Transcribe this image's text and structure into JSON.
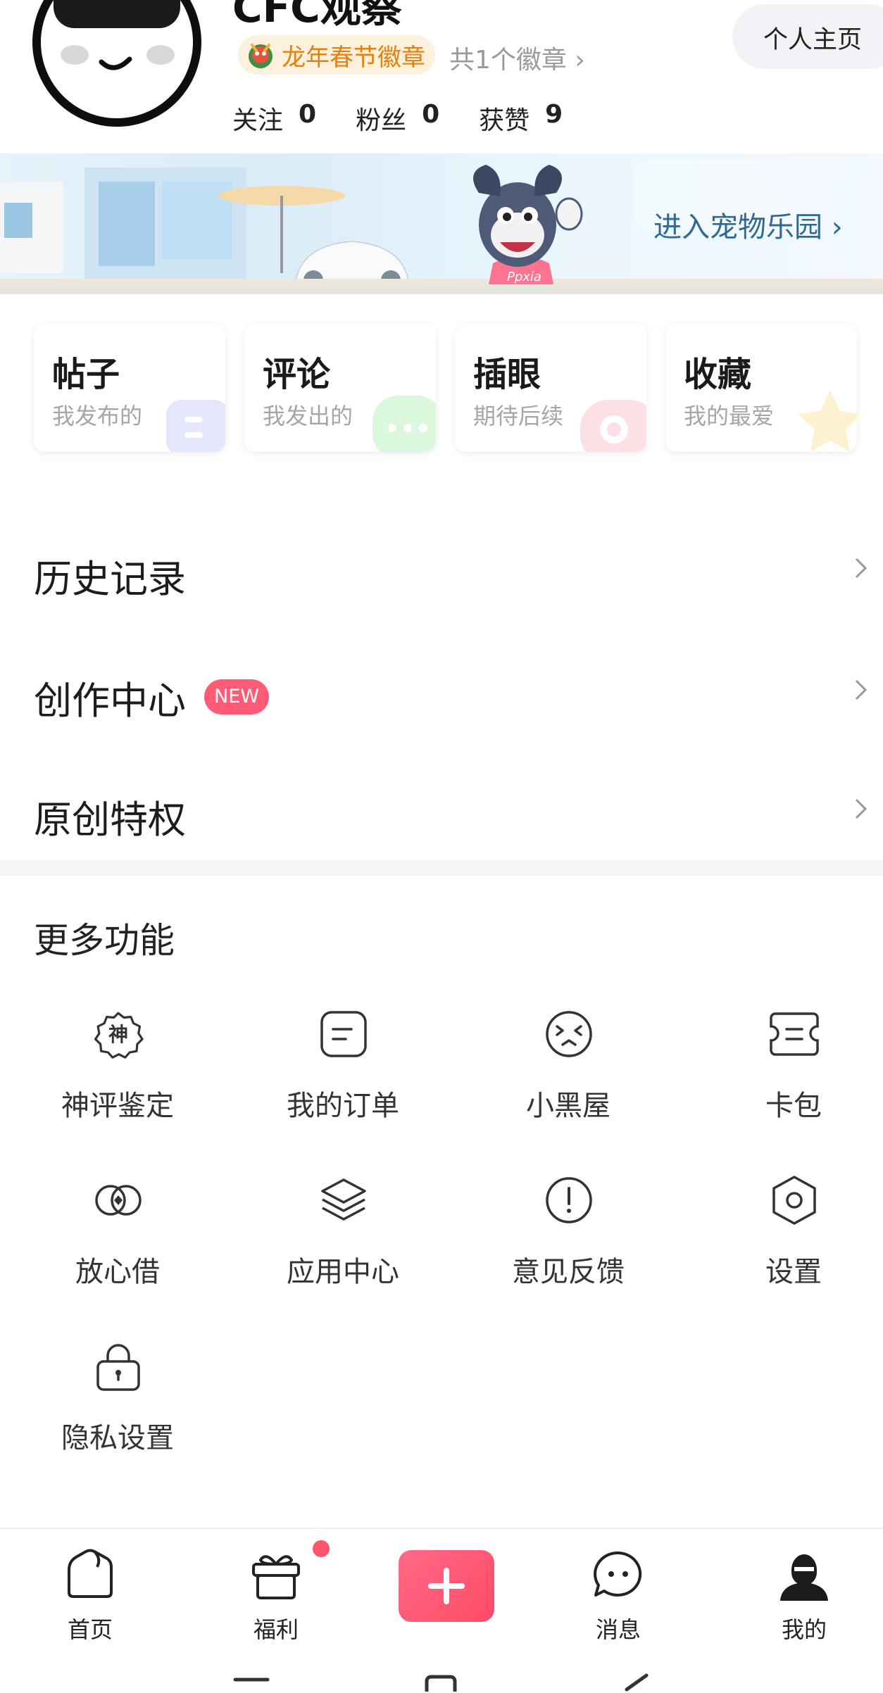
{
  "profile": {
    "username": "CFC观察",
    "badge_name": "龙年春节徽章",
    "badge_count": "共1个徽章 ›",
    "homepage_button": "个人主页",
    "stats": [
      {
        "label": "关注",
        "value": "0"
      },
      {
        "label": "粉丝",
        "value": "0"
      },
      {
        "label": "获赞",
        "value": "9"
      }
    ]
  },
  "banner": {
    "cta": "进入宠物乐园 ›",
    "mascot_shirt": "Ppxia"
  },
  "cards": [
    {
      "title": "帖子",
      "subtitle": "我发布的"
    },
    {
      "title": "评论",
      "subtitle": "我发出的"
    },
    {
      "title": "插眼",
      "subtitle": "期待后续"
    },
    {
      "title": "收藏",
      "subtitle": "我的最爱"
    }
  ],
  "menu_rows": [
    {
      "label": "历史记录"
    },
    {
      "label": "创作中心",
      "badge": "NEW"
    },
    {
      "label": "原创特权"
    }
  ],
  "more_functions": {
    "title": "更多功能",
    "items": [
      {
        "label": "神评鉴定",
        "icon": "shen-badge-icon",
        "icon_text": "神"
      },
      {
        "label": "我的订单",
        "icon": "order-icon"
      },
      {
        "label": "小黑屋",
        "icon": "dizzy-face-icon"
      },
      {
        "label": "卡包",
        "icon": "card-wallet-icon"
      },
      {
        "label": "放心借",
        "icon": "loan-icon"
      },
      {
        "label": "应用中心",
        "icon": "layers-icon"
      },
      {
        "label": "意见反馈",
        "icon": "feedback-icon"
      },
      {
        "label": "设置",
        "icon": "settings-hexagon-icon"
      },
      {
        "label": "隐私设置",
        "icon": "lock-icon"
      }
    ]
  },
  "bottom_nav": [
    {
      "label": "首页",
      "icon": "home-icon"
    },
    {
      "label": "福利",
      "icon": "gift-icon",
      "has_dot": true
    },
    {
      "label": "",
      "icon": "plus-icon"
    },
    {
      "label": "消息",
      "icon": "message-icon"
    },
    {
      "label": "我的",
      "icon": "profile-icon",
      "active": true
    }
  ],
  "colors": {
    "accent": "#ff5470",
    "badge_text": "#e0820f",
    "banner_text": "#2f6a95"
  }
}
